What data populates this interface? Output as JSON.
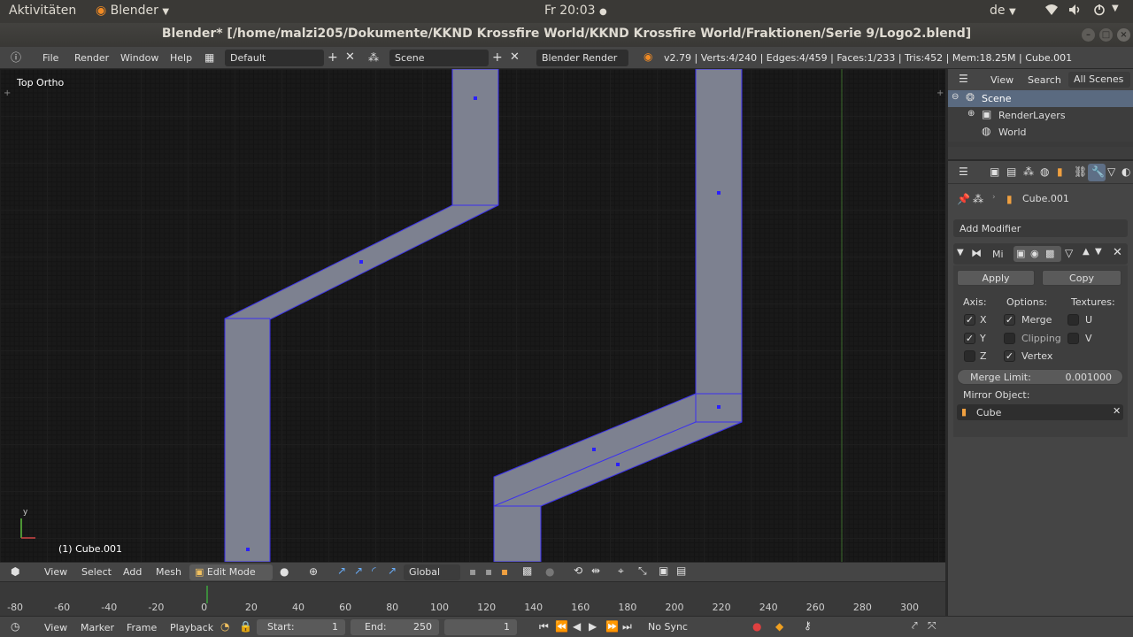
{
  "topbar": {
    "activities": "Aktivitäten",
    "app": "Blender",
    "clock": "Fr 20:03",
    "lang": "de"
  },
  "window": {
    "title": "Blender* [/home/malzi205/Dokumente/KKND Krossfire World/KKND Krossfire World/Fraktionen/Serie 9/Logo2.blend]"
  },
  "info_header": {
    "menus": [
      "File",
      "Render",
      "Window",
      "Help"
    ],
    "screen_layout": "Default",
    "scene": "Scene",
    "engine": "Blender Render",
    "stats": "v2.79 | Verts:4/240 | Edges:4/459 | Faces:1/233 | Tris:452 | Mem:18.25M | Cube.001"
  },
  "viewport": {
    "view_name": "Top Ortho",
    "object_label": "(1) Cube.001",
    "axis_y": "y",
    "colors": {
      "mesh": "#7d8190",
      "edge": "#3a2ff0",
      "vertex": "#2a20ff"
    }
  },
  "view3d_header": {
    "menus": [
      "View",
      "Select",
      "Add",
      "Mesh"
    ],
    "mode": "Edit Mode",
    "orientation": "Global"
  },
  "timeline": {
    "ticks": [
      "-80",
      "-60",
      "-40",
      "-20",
      "0",
      "20",
      "40",
      "60",
      "80",
      "100",
      "120",
      "140",
      "160",
      "180",
      "200",
      "220",
      "240",
      "260",
      "280",
      "300"
    ]
  },
  "timeline_header": {
    "menus": [
      "View",
      "Marker",
      "Frame",
      "Playback"
    ],
    "start_label": "Start:",
    "start_value": "1",
    "end_label": "End:",
    "end_value": "250",
    "current_frame": "1",
    "sync": "No Sync"
  },
  "outliner": {
    "menus": [
      "View",
      "Search"
    ],
    "filter": "All Scenes",
    "items": [
      {
        "label": "Scene"
      },
      {
        "label": "RenderLayers"
      },
      {
        "label": "World"
      }
    ]
  },
  "properties": {
    "object_name": "Cube.001",
    "add_modifier": "Add Modifier",
    "modifier_name": "Mi",
    "apply": "Apply",
    "copy": "Copy",
    "axis_title": "Axis:",
    "options_title": "Options:",
    "textures_title": "Textures:",
    "axis": [
      {
        "label": "X",
        "checked": true
      },
      {
        "label": "Y",
        "checked": true
      },
      {
        "label": "Z",
        "checked": false
      }
    ],
    "options": [
      {
        "label": "Merge",
        "checked": true
      },
      {
        "label": "Clipping",
        "checked": false
      },
      {
        "label": "Vertex",
        "checked": true
      }
    ],
    "textures": [
      {
        "label": "U",
        "checked": false
      },
      {
        "label": "V",
        "checked": false
      }
    ],
    "merge_limit_label": "Merge Limit:",
    "merge_limit_value": "0.001000",
    "mirror_object_label": "Mirror Object:",
    "mirror_object_value": "Cube"
  }
}
